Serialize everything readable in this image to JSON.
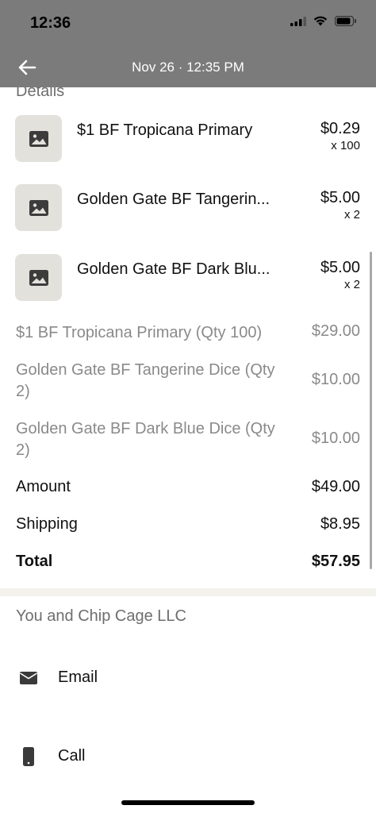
{
  "status_bar": {
    "time": "12:36"
  },
  "header": {
    "title": "Nov 26 · 12:35 PM"
  },
  "details": {
    "heading": "Details",
    "items": [
      {
        "name": "$1 BF Tropicana Primary",
        "price": "$0.29",
        "qty": "x 100"
      },
      {
        "name": "Golden Gate BF Tangerin...",
        "price": "$5.00",
        "qty": "x 2"
      },
      {
        "name": "Golden Gate BF Dark Blu...",
        "price": "$5.00",
        "qty": "x 2"
      }
    ],
    "lines": [
      {
        "label": "$1 BF Tropicana Primary (Qty 100)",
        "value": "$29.00"
      },
      {
        "label": "Golden Gate BF Tangerine Dice (Qty 2)",
        "value": "$10.00"
      },
      {
        "label": "Golden Gate BF Dark Blue Dice (Qty 2)",
        "value": "$10.00"
      }
    ],
    "amount": {
      "label": "Amount",
      "value": "$49.00"
    },
    "shipping": {
      "label": "Shipping",
      "value": "$8.95"
    },
    "total": {
      "label": "Total",
      "value": "$57.95"
    }
  },
  "party": {
    "heading": "You and Chip Cage LLC",
    "email_label": "Email",
    "call_label": "Call"
  },
  "colors": {
    "header_bg": "#7b7b7b",
    "thumb_bg": "#e3e1dc",
    "muted_text": "#8a8a8a"
  }
}
